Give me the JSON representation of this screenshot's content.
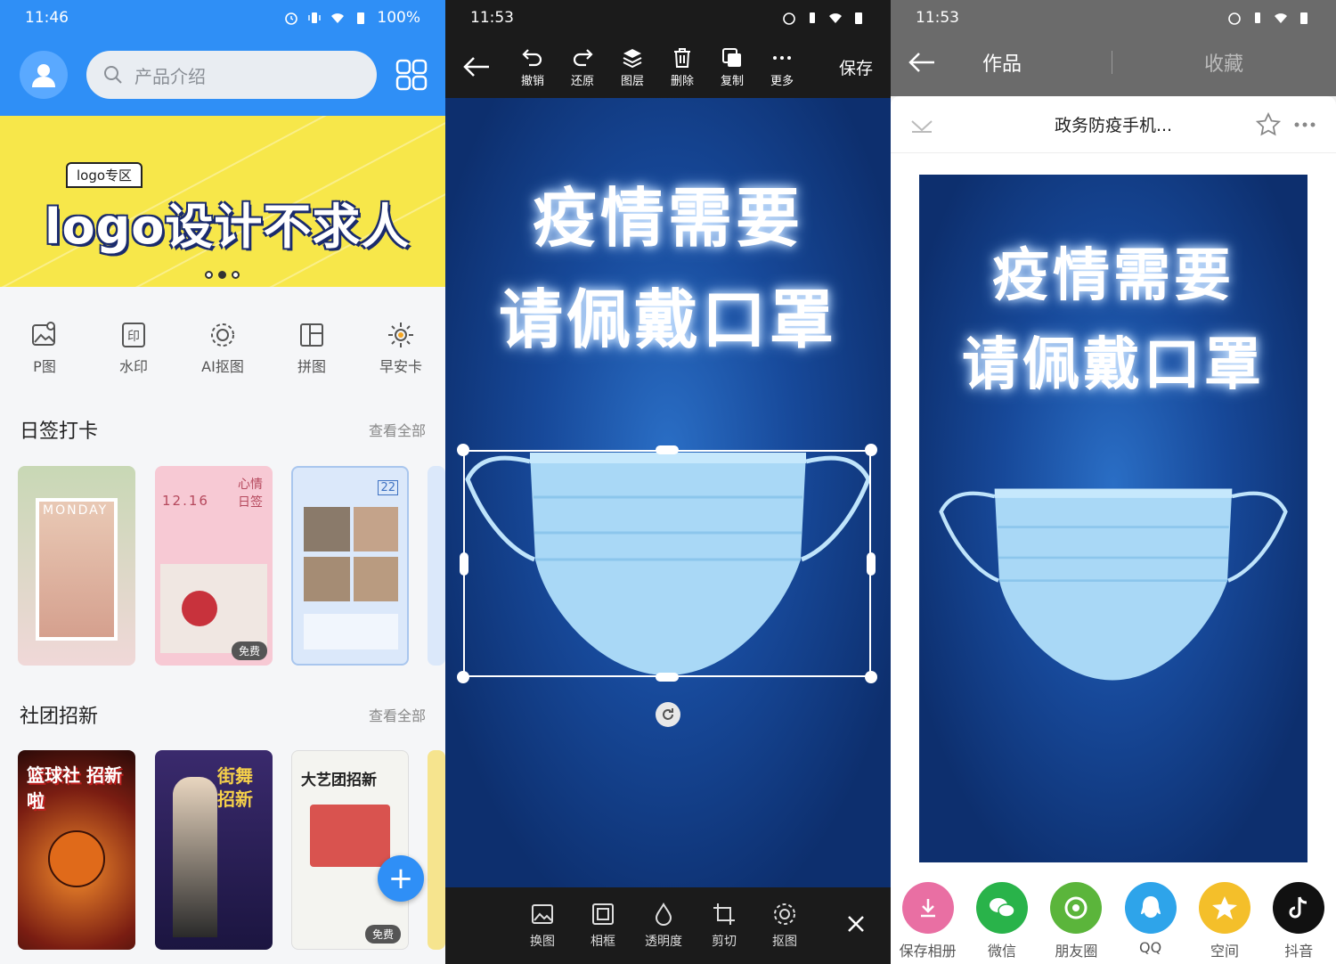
{
  "left_panel": {
    "status": {
      "time": "11:46",
      "battery": "100%"
    },
    "search_placeholder": "产品介绍",
    "banner": {
      "tag": "logo专区",
      "headline": "logo设计不求人"
    },
    "tools": [
      {
        "label": "P图",
        "icon": "image-edit-icon"
      },
      {
        "label": "水印",
        "icon": "watermark-icon"
      },
      {
        "label": "AI抠图",
        "icon": "ai-cutout-icon"
      },
      {
        "label": "拼图",
        "icon": "collage-icon"
      },
      {
        "label": "早安卡",
        "icon": "sun-icon"
      }
    ],
    "section1": {
      "title": "日签打卡",
      "more": "查看全部"
    },
    "section2": {
      "title": "社团招新",
      "more": "查看全部"
    },
    "cards1": [
      {
        "text": "MONDAY"
      },
      {
        "text": "12.16",
        "sub": "心情 日签",
        "badge": "免费"
      },
      {
        "text": "22"
      }
    ],
    "cards2": [
      {
        "text": "篮球社 招新啦"
      },
      {
        "text": "街舞 招新"
      },
      {
        "text": "大艺团招新",
        "badge": "免费"
      }
    ],
    "fab": "+"
  },
  "middle_panel": {
    "status": {
      "time": "11:53"
    },
    "toolbar": [
      {
        "label": "撤销",
        "icon": "undo-icon"
      },
      {
        "label": "还原",
        "icon": "redo-icon"
      },
      {
        "label": "图层",
        "icon": "layers-icon"
      },
      {
        "label": "删除",
        "icon": "trash-icon"
      },
      {
        "label": "复制",
        "icon": "copy-icon"
      },
      {
        "label": "更多",
        "icon": "more-icon"
      }
    ],
    "save": "保存",
    "poster_line1": "疫情需要",
    "poster_line2": "请佩戴口罩",
    "bottom_tools": [
      {
        "label": "换图",
        "icon": "replace-image-icon"
      },
      {
        "label": "相框",
        "icon": "frame-icon"
      },
      {
        "label": "透明度",
        "icon": "opacity-icon"
      },
      {
        "label": "剪切",
        "icon": "crop-icon"
      },
      {
        "label": "抠图",
        "icon": "cutout-icon"
      }
    ]
  },
  "right_panel": {
    "status": {
      "time": "11:53"
    },
    "tabs": [
      "作品",
      "收藏"
    ],
    "title": "政务防疫手机...",
    "poster_line1": "疫情需要",
    "poster_line2": "请佩戴口罩",
    "share": [
      {
        "label": "保存相册",
        "color": "#e96fa3",
        "icon": "download-icon"
      },
      {
        "label": "微信",
        "color": "#29b34a",
        "icon": "wechat-icon"
      },
      {
        "label": "朋友圈",
        "color": "#5bb53b",
        "icon": "moments-icon"
      },
      {
        "label": "QQ",
        "color": "#2ea4ea",
        "icon": "qq-icon"
      },
      {
        "label": "空间",
        "color": "#f4bf2a",
        "icon": "qzone-icon"
      },
      {
        "label": "抖音",
        "color": "#111111",
        "icon": "douyin-icon"
      }
    ]
  }
}
